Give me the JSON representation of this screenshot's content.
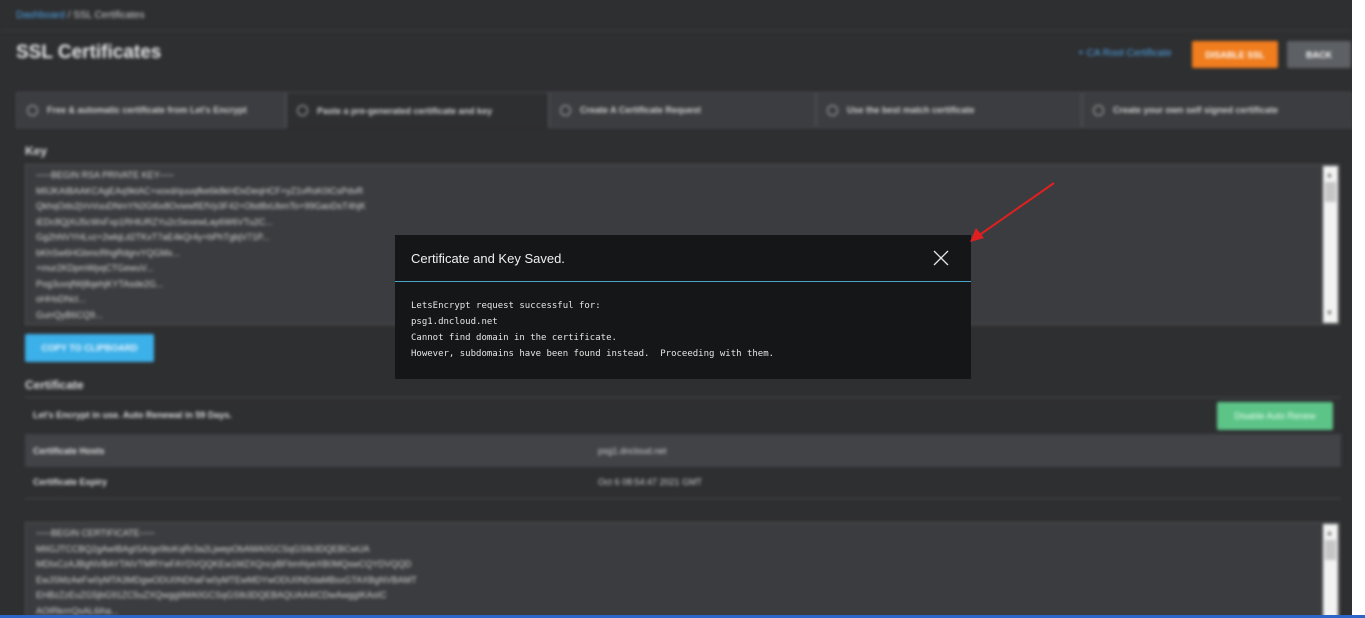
{
  "breadcrumb": {
    "dashboard": "Dashboard",
    "separator": " / ",
    "current": "SSL Certificates"
  },
  "header": {
    "title": "SSL Certificates",
    "ca_link": "+ CA Root Certificate",
    "disable_ssl": "DISABLE SSL",
    "back": "BACK"
  },
  "tabs": [
    {
      "label": "Free & automatic certificate from Let's Encrypt",
      "selected": false
    },
    {
      "label": "Paste a pre-generated certificate and key",
      "selected": true
    },
    {
      "label": "Create A Certificate Request",
      "selected": false
    },
    {
      "label": "Use the best match certificate",
      "selected": false
    },
    {
      "label": "Create your own self signed certificate",
      "selected": false
    }
  ],
  "key_section": {
    "label": "Key",
    "lines": [
      "-----BEGIN RSA PRIVATE KEY-----",
      "MIIJKAIBAAKCAgEAq9ktAC+xoxd/quuqfke6k8kHDxDeqHCF+yZ1vRsK0ICsPdvR",
      "QkhqOds2jVvVuuDNmYN2Gt6x8OvwwfIEfVp3F42+Obd8xUbmTo+99GaoDsT4hjK",
      "iEDc8QjXiJ5cWxFxp1RHlURZYu2cSexewLay6W6VTu2C...",
      "Gg2hNVYHLvz+2wlqLd2TKxT7aE4kQr4y+bPhTgbjV71P...",
      "bKhSw6HGbmcRhgRdgrvYQGMx...",
      "+mur2KDpmWpqCTGewuV...",
      "Pog3uvqfWj8qehjKYTAsde2G...",
      "oHHsDNcl...",
      "GurrQyB6CQ9..."
    ],
    "copy_button": "COPY TO CLIPBOARD"
  },
  "cert_section": {
    "label": "Certificate",
    "status_text": "Let's Encrypt in use. Auto Renewal in 59 Days.",
    "renew_button": "Disable Auto Renew",
    "hosts_label": "Certificate Hosts",
    "hosts_value": "psg1.dncloud.net",
    "expiry_label": "Certificate Expiry",
    "expiry_value": "Oct 6 08:54:47 2021 GMT",
    "lines": [
      "-----BEGIN CERTIFICATE-----",
      "MIIGJTCCBQ2gAwIBAgISA/go9toKqRr3a2LjwepObAMA0GCSqGSIb3DQEBCwUA",
      "MDIxCzAJBgNVBAYTAlVTMRYwFAYDVQQKEw1MZXQncyBFbmNyeXB0MQswCQYDVQQD",
      "EwJSMzAeFw0yMTA3MDgwODU0NDhaFw0yMTEwMDYwODU0NDdaMBsxGTAXBgNVBAMT",
      "EHBzZzEuZG5jbG91ZC5uZXQwggIiMA0GCSqGSIb3DQEBAQUAA4ICDwAwggIKAoIC",
      "AOIRkrrrQsAL6iha..."
    ]
  },
  "modal": {
    "title": "Certificate and Key Saved.",
    "lines": [
      "LetsEncrypt request successful for:",
      "psg1.dncloud.net",
      "Cannot find domain in the certificate.",
      "However, subdomains have been found instead.  Proceeding with them."
    ]
  },
  "colors": {
    "accent_orange": "#f07d1e",
    "accent_blue": "#3cb0e8",
    "accent_green": "#5cc487",
    "annotation_arrow": "#e02020"
  }
}
